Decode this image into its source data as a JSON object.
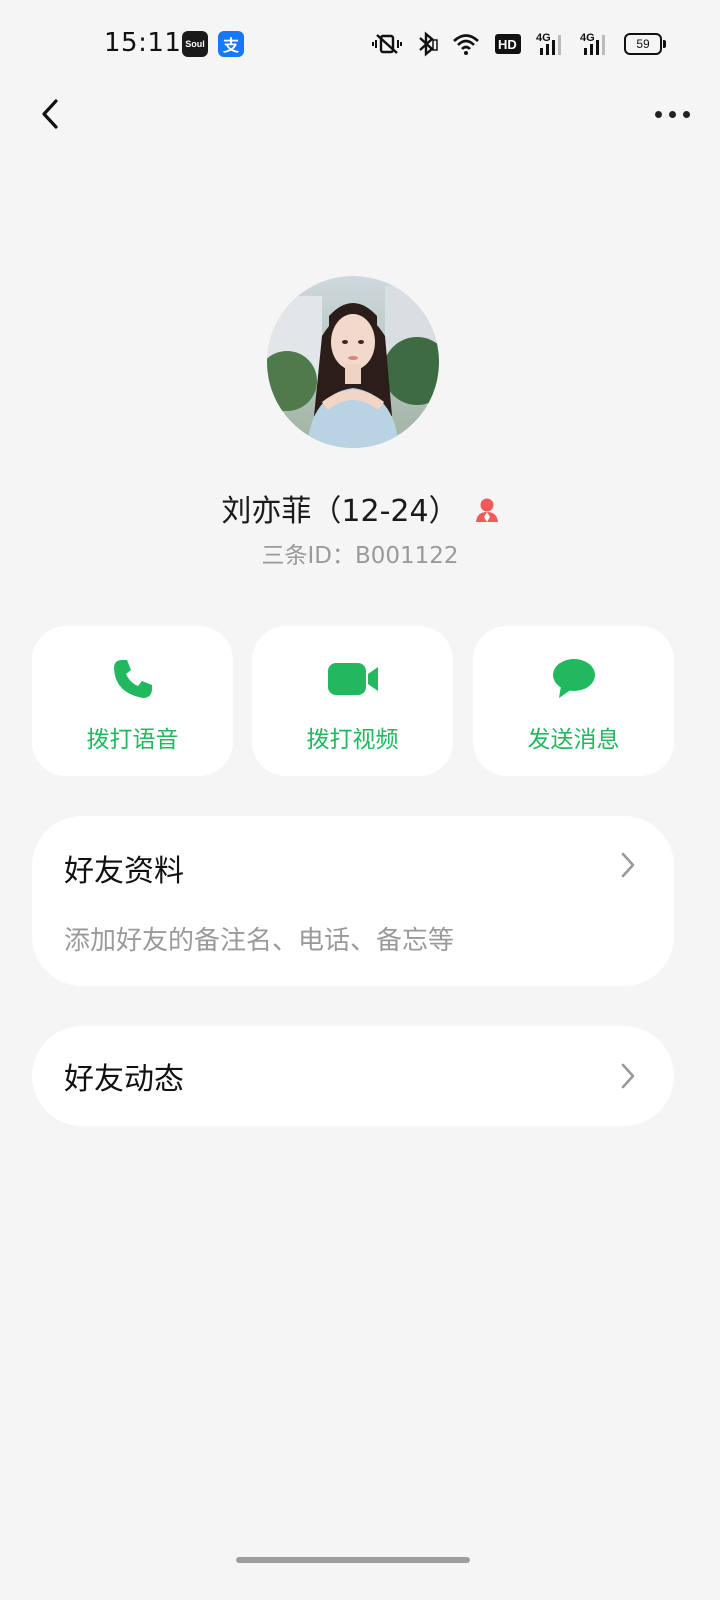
{
  "status_bar": {
    "time": "15:11",
    "apps": [
      "Soul",
      "支"
    ],
    "network": [
      "4G",
      "4G"
    ],
    "hd_label": "HD",
    "battery": "59"
  },
  "nav": {
    "back_icon": "chevron-left-icon",
    "more_icon": "more-dots-icon"
  },
  "profile": {
    "name": "刘亦菲（12-24）",
    "id_text": "三条ID：B001122",
    "gender_icon": "female-user-icon",
    "gender_color": "#f05a5a"
  },
  "actions": [
    {
      "label": "拨打语音",
      "icon": "phone-icon"
    },
    {
      "label": "拨打视频",
      "icon": "video-camera-icon"
    },
    {
      "label": "发送消息",
      "icon": "chat-bubble-icon"
    }
  ],
  "sections": {
    "friend_profile": {
      "title": "好友资料",
      "subtitle": "添加好友的备注名、电话、备忘等"
    },
    "friend_moments": {
      "title": "好友动态"
    }
  },
  "colors": {
    "accent": "#22b85f",
    "background": "#f5f5f5",
    "card": "#ffffff"
  }
}
